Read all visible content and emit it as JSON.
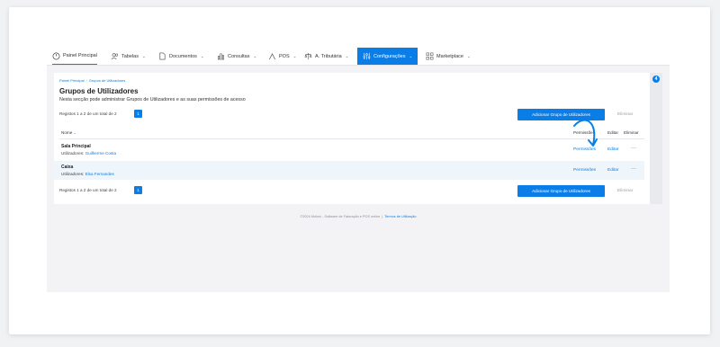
{
  "nav": {
    "items": [
      {
        "label": "Painel Principal",
        "icon": "dashboard-icon"
      },
      {
        "label": "Tabelas",
        "icon": "users-icon"
      },
      {
        "label": "Documentos",
        "icon": "document-icon"
      },
      {
        "label": "Consultas",
        "icon": "bar-chart-icon"
      },
      {
        "label": "POS",
        "icon": "pos-icon"
      },
      {
        "label": "A. Tributária",
        "icon": "scale-icon"
      },
      {
        "label": "Configurações",
        "icon": "settings-icon"
      },
      {
        "label": "Marketplace",
        "icon": "grid-icon"
      }
    ],
    "active": "Configurações",
    "caret": "⌄"
  },
  "breadcrumb": {
    "home": "Painel Principal",
    "sep": "/",
    "current": "Grupos de Utilizadores"
  },
  "page": {
    "title": "Grupos de Utilizadores",
    "subtitle": "Nesta secção pode administrar Grupos de Utilizadores e as suas permissões de acesso"
  },
  "records_text": "Registos 1 a 2 de um total de 2",
  "page_number": "1",
  "add_button": "Adicionar Grupo de Utilizadores",
  "delete_link": "Eliminar",
  "table": {
    "headers": {
      "name": "Nome",
      "sort": "⌄",
      "permissions": "Permissões",
      "edit": "Editar",
      "delete": "Eliminar"
    },
    "rows": [
      {
        "name": "Sala Principal",
        "users_label": "Utilizadores:",
        "users": "Guilherme Costa",
        "permissions": "Permissões",
        "edit": "Editar",
        "more": "···"
      },
      {
        "name": "Caixa",
        "users_label": "Utilizadores:",
        "users": "Elsa Fernandes",
        "permissions": "Permissões",
        "edit": "Editar",
        "more": "···"
      }
    ]
  },
  "footer": {
    "copyright": "©2024 Moloni - Software de Faturação e POS online",
    "sep": "|",
    "terms": "Termos de Utilização"
  },
  "notification_count": "4",
  "colors": {
    "accent": "#0a7ee6",
    "row_alt": "#eef5fb",
    "muted": "#9aa0a6"
  }
}
